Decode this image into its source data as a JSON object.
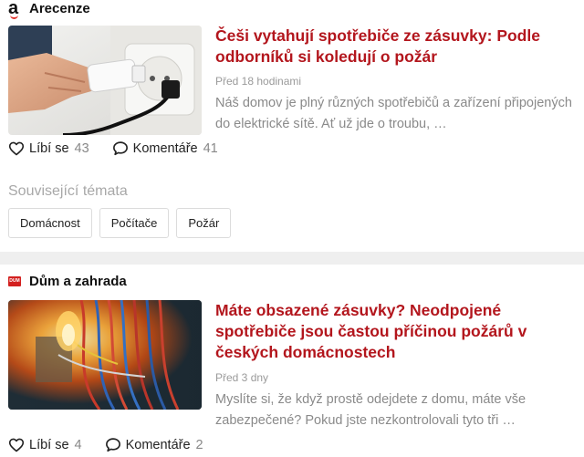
{
  "articles": [
    {
      "source": {
        "name": "Arecenze",
        "logo": "a"
      },
      "title": "Češi vytahují spotřebiče ze zásuvky: Podle odborníků si koledují o požár",
      "time": "Před 18 hodinami",
      "perex": "Náš domov je plný různých spotřebičů a zařízení připojených do elektrické sítě. Ať už jde o troubu, …",
      "likes_label": "Líbí se",
      "likes": "43",
      "comments_label": "Komentáře",
      "comments": "41",
      "image": "hand-unplugging-plug-from-socket"
    },
    {
      "source": {
        "name": "Dům a zahrada",
        "logo": "DUM"
      },
      "title": "Máte obsazené zásuvky? Neodpojené spotřebiče jsou častou příčinou požárů v českých domácnostech",
      "time": "Před 3 dny",
      "perex": "Myslíte si, že když prostě odejdete z domu, máte vše zabezpečené? Pokud jste nezkontrolovali tyto tři …",
      "likes_label": "Líbí se",
      "likes": "4",
      "comments_label": "Komentáře",
      "comments": "2",
      "image": "burning-electrical-wires"
    }
  ],
  "related": {
    "label": "Související témata",
    "tags": [
      "Domácnost",
      "Počítače",
      "Požár"
    ]
  },
  "colors": {
    "title": "#b3161d",
    "muted": "#9a9a9a",
    "divider": "#efefef"
  },
  "icons": [
    "heart-icon",
    "comment-icon"
  ]
}
